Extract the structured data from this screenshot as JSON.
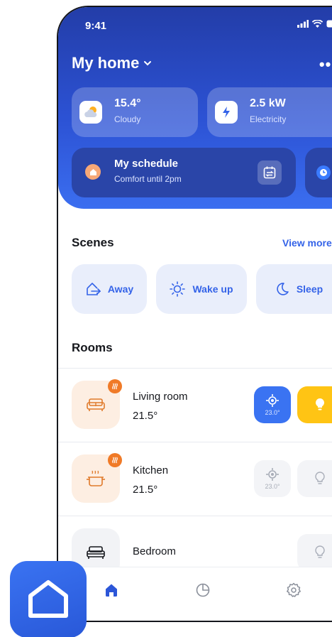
{
  "status_bar": {
    "time": "9:41"
  },
  "header": {
    "title": "My home"
  },
  "weather": {
    "value": "15.4°",
    "label": "Cloudy"
  },
  "electricity": {
    "value": "2.5 kW",
    "label": "Electricity"
  },
  "schedule": {
    "title": "My schedule",
    "subtitle": "Comfort until 2pm"
  },
  "scenes": {
    "heading": "Scenes",
    "view_more": "View more",
    "items": [
      {
        "label": "Away",
        "icon": "exit-icon"
      },
      {
        "label": "Wake up",
        "icon": "sun-icon"
      },
      {
        "label": "Sleep",
        "icon": "moon-icon"
      }
    ]
  },
  "rooms": {
    "heading": "Rooms",
    "items": [
      {
        "name": "Living room",
        "temp": "21.5°",
        "thermostat": "23.0°",
        "thermostat_active": true,
        "light_active": true,
        "heating": true
      },
      {
        "name": "Kitchen",
        "temp": "21.5°",
        "thermostat": "23.0°",
        "thermostat_active": false,
        "light_active": false,
        "heating": true
      },
      {
        "name": "Bedroom",
        "temp": "",
        "light_active": false,
        "heating": false
      }
    ]
  },
  "colors": {
    "accent": "#3463e8",
    "hero_top": "#233da8",
    "hero_bottom": "#3b6ef0",
    "heating_badge": "#f07a27",
    "light_on": "#ffc414"
  },
  "tabs": [
    {
      "icon": "home-icon",
      "active": true
    },
    {
      "icon": "stats-icon",
      "active": false
    },
    {
      "icon": "settings-icon",
      "active": false
    }
  ]
}
